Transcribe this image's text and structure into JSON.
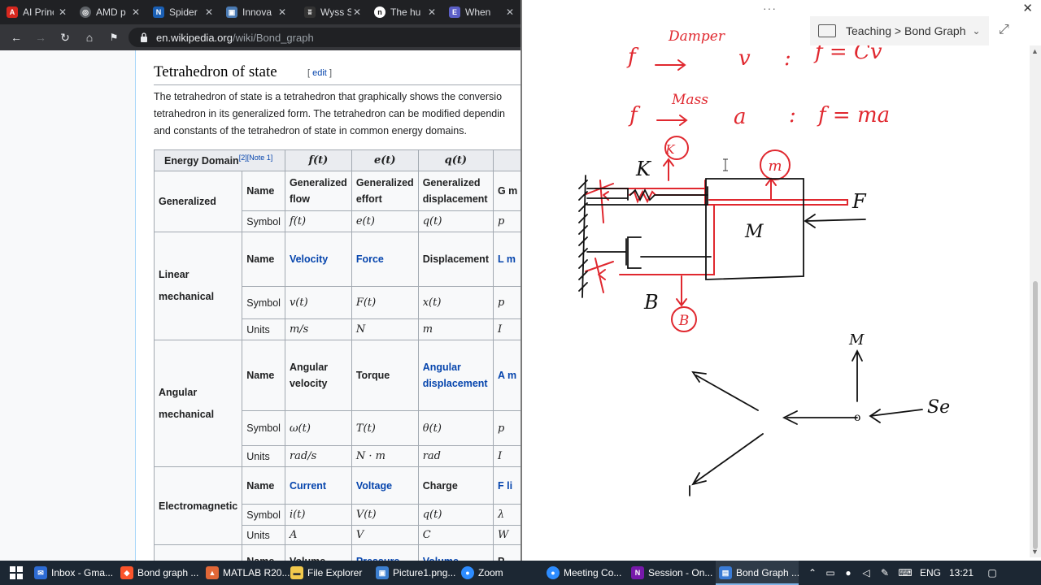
{
  "browser": {
    "tabs": [
      {
        "label": "AI Princ",
        "icon": "acrobat-icon",
        "color": "#d7281f"
      },
      {
        "label": "AMD p",
        "icon": "globe-icon",
        "color": "#5f6368"
      },
      {
        "label": "Spider",
        "icon": "n-letter-icon",
        "color": "#1a5fb4"
      },
      {
        "label": "Innova",
        "icon": "image-icon",
        "color": "#4a7ab3"
      },
      {
        "label": "Wyss S",
        "icon": "wyss-icon",
        "color": "#333"
      },
      {
        "label": "The hu",
        "icon": "n-circle-icon",
        "color": "#111"
      },
      {
        "label": "When",
        "icon": "e-letter-icon",
        "color": "#5b5fc7"
      }
    ],
    "url_domain": "en.wikipedia.org",
    "url_path": "/wiki/Bond_graph"
  },
  "wiki": {
    "heading": "Tetrahedron of state",
    "edit_open": "[",
    "edit_label": "edit",
    "edit_close": "]",
    "para": [
      "The tetrahedron of state is a tetrahedron that graphically shows the conversio",
      "tetrahedron in its generalized form. The tetrahedron can be modified dependin",
      "and constants of the tetrahedron of state in common energy domains."
    ],
    "table": {
      "header": {
        "domain": "Energy Domain",
        "sup": "[2][Note 1]",
        "f": "f(t)",
        "e": "e(t)",
        "q": "q(t)"
      },
      "generalized": {
        "label": "Generalized",
        "name_label": "Name",
        "symbol_label": "Symbol",
        "f_name": "Generalized flow",
        "e_name": "Generalized effort",
        "q_name": "Generalized displacement",
        "p_name": "G m",
        "f_sym": "f(t)",
        "e_sym": "e(t)",
        "q_sym": "q(t)",
        "p_sym": "p"
      },
      "linear": {
        "label": "Linear mechanical",
        "name_label": "Name",
        "symbol_label": "Symbol",
        "units_label": "Units",
        "f_name": "Velocity",
        "e_name": "Force",
        "q_name": "Displacement",
        "p_name": "L m",
        "f_sym": "v(t)",
        "e_sym": "F(t)",
        "q_sym": "x(t)",
        "p_sym": "p",
        "f_unit": "m/s",
        "e_unit": "N",
        "q_unit": "m",
        "p_unit": "I"
      },
      "angular": {
        "label": "Angular mechanical",
        "name_label": "Name",
        "symbol_label": "Symbol",
        "units_label": "Units",
        "f_name": "Angular velocity",
        "e_name": "Torque",
        "q_name": "Angular displacement",
        "p_name": "A m",
        "f_sym": "ω(t)",
        "e_sym": "T(t)",
        "q_sym": "θ(t)",
        "p_sym": "p",
        "f_unit": "rad/s",
        "e_unit": "N · m",
        "q_unit": "rad",
        "p_unit": "I"
      },
      "electro": {
        "label": "Electromagnetic",
        "name_label": "Name",
        "symbol_label": "Symbol",
        "units_label": "Units",
        "f_name": "Current",
        "e_name": "Voltage",
        "q_name": "Charge",
        "p_name": "F li",
        "f_sym": "i(t)",
        "e_sym": "V(t)",
        "q_sym": "q(t)",
        "p_sym": "λ",
        "f_unit": "A",
        "e_unit": "V",
        "q_unit": "C",
        "p_unit": "W"
      },
      "next": {
        "name_label": "Name",
        "f_name": "Volume",
        "e_name": "Pressure",
        "q_name": "Volume",
        "p_name": "P"
      }
    }
  },
  "onenote": {
    "dots": "···",
    "breadcrumb": "Teaching > Bond Graph",
    "ink": {
      "line1_f": "f",
      "line1_over": "Damper",
      "line1_v": "v",
      "line1_colon": ":",
      "line1_eq": "f = Cv",
      "line2_f": "f",
      "line2_over": "Mass",
      "line2_a": "a",
      "line2_colon": ":",
      "line2_eq": "f = ma",
      "spring_label": "K",
      "spring_circle": "K",
      "mass_circle": "m",
      "mass_label": "M",
      "force_label": "F",
      "damper_label": "B",
      "damper_circle": "B",
      "node_top": "M",
      "node_right": "Se",
      "node_mark": "o"
    }
  },
  "taskbar": {
    "items": [
      {
        "label": "Inbox - Gma...",
        "icon": "mail-icon",
        "color": "#2d6bd3"
      },
      {
        "label": "Bond graph ...",
        "icon": "brave-icon",
        "color": "#fb542b"
      },
      {
        "label": "MATLAB R20...",
        "icon": "matlab-icon",
        "color": "#e16737"
      },
      {
        "label": "File Explorer",
        "icon": "folder-icon",
        "color": "#f2c94c"
      },
      {
        "label": "Picture1.png...",
        "icon": "photos-icon",
        "color": "#3c7fd0"
      },
      {
        "label": "Zoom",
        "icon": "zoom-icon",
        "color": "#2d8cff"
      },
      {
        "label": "Meeting Co...",
        "icon": "zoom-meeting-icon",
        "color": "#2d8cff"
      },
      {
        "label": "Session - On...",
        "icon": "onenote-icon",
        "color": "#7719aa"
      },
      {
        "label": "Bond Graph ...",
        "icon": "onenote-window-icon",
        "color": "#3a7bd5"
      }
    ],
    "language": "ENG",
    "time": "13:21"
  }
}
